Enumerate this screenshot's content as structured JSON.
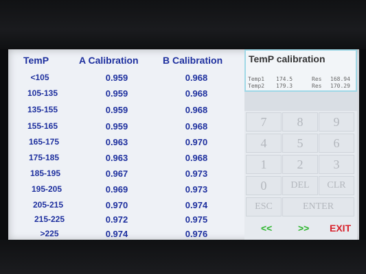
{
  "table": {
    "headers": {
      "temp": "TemP",
      "a": "A Calibration",
      "b": "B Calibration"
    },
    "rows": [
      {
        "temp": "<105",
        "a": "0.959",
        "b": "0.968"
      },
      {
        "temp": "105-135",
        "a": "0.959",
        "b": "0.968"
      },
      {
        "temp": "135-155",
        "a": "0.959",
        "b": "0.968"
      },
      {
        "temp": "155-165",
        "a": "0.959",
        "b": "0.968"
      },
      {
        "temp": "165-175",
        "a": "0.963",
        "b": "0.970"
      },
      {
        "temp": "175-185",
        "a": "0.963",
        "b": "0.968"
      },
      {
        "temp": "185-195",
        "a": "0.967",
        "b": "0.973"
      },
      {
        "temp": "195-205",
        "a": "0.969",
        "b": "0.973"
      },
      {
        "temp": "205-215",
        "a": "0.970",
        "b": "0.974"
      },
      {
        "temp": "215-225",
        "a": "0.972",
        "b": "0.975"
      },
      {
        "temp": ">225",
        "a": "0.974",
        "b": "0.976"
      }
    ]
  },
  "panel": {
    "title": "TemP calibration",
    "temp1_label": "Temp1",
    "temp1_value": "174.5",
    "res1_label": "Res",
    "res1_value": "168.94",
    "temp2_label": "Temp2",
    "temp2_value": "179.3",
    "res2_label": "Res",
    "res2_value": "170.29"
  },
  "keypad": {
    "k7": "7",
    "k8": "8",
    "k9": "9",
    "k4": "4",
    "k5": "5",
    "k6": "6",
    "k1": "1",
    "k2": "2",
    "k3": "3",
    "k0": "0",
    "del": "DEL",
    "clr": "CLR",
    "esc": "ESC",
    "enter": "ENTER"
  },
  "nav": {
    "prev": "<<",
    "next": ">>",
    "exit": "EXIT"
  },
  "colors": {
    "text_blue": "#1d2f9e",
    "nav_green": "#2bb52b",
    "exit_red": "#d8202a",
    "panel_border": "#9fd8e6"
  }
}
